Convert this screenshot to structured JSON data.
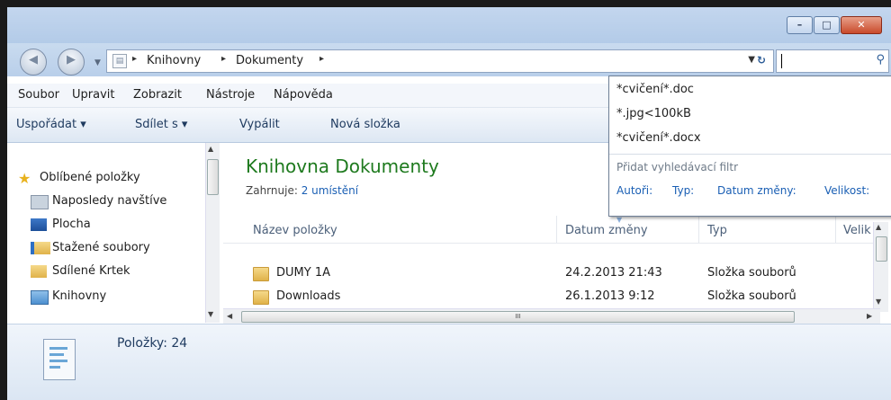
{
  "window": {
    "minimize_glyph": "–",
    "maximize_glyph": "□",
    "close_glyph": "✕"
  },
  "nav": {
    "back_glyph": "◀",
    "forward_glyph": "▶",
    "history_glyph": "▼"
  },
  "address": {
    "crumbs": [
      "Knihovny",
      "Dokumenty"
    ],
    "separator": "▸",
    "dropdown_glyph": "▼",
    "refresh_glyph": "↻"
  },
  "search": {
    "icon_glyph": "⚲"
  },
  "menu": [
    "Soubor",
    "Upravit",
    "Zobrazit",
    "Nástroje",
    "Nápověda"
  ],
  "commands": [
    "Uspořádat ▾",
    "Sdílet s ▾",
    "Vypálit",
    "Nová složka"
  ],
  "sidebar": {
    "items": [
      "Oblíbené položky",
      "Naposledy navštíve",
      "Plocha",
      "Stažené soubory",
      "Sdílené Krtek",
      "Knihovny"
    ]
  },
  "library": {
    "title": "Knihovna Dokumenty",
    "includes_label": "Zahrnuje:",
    "includes_link": "2 umístění"
  },
  "columns": [
    "Název položky",
    "Datum změny",
    "Typ",
    "Velik"
  ],
  "rows": [
    {
      "name": "DUMY 1A",
      "date": "24.2.2013 21:43",
      "type": "Složka souborů"
    },
    {
      "name": "Downloads",
      "date": "26.1.2013 9:12",
      "type": "Složka souborů"
    }
  ],
  "hscroll_grip": "III",
  "status": {
    "count": "Položky: 24"
  },
  "suggestions": {
    "items": [
      "*cvičení*.doc",
      "*.jpg<100kB",
      "*cvičení*.docx"
    ],
    "add_filter_label": "Přidat vyhledávací filtr",
    "filters": [
      "Autoři:",
      "Typ:",
      "Datum změny:",
      "Velikost:"
    ]
  },
  "colors": {
    "library_title": "#1e7a1e",
    "link": "#1a5fb4",
    "folder": "#e0b24a"
  }
}
